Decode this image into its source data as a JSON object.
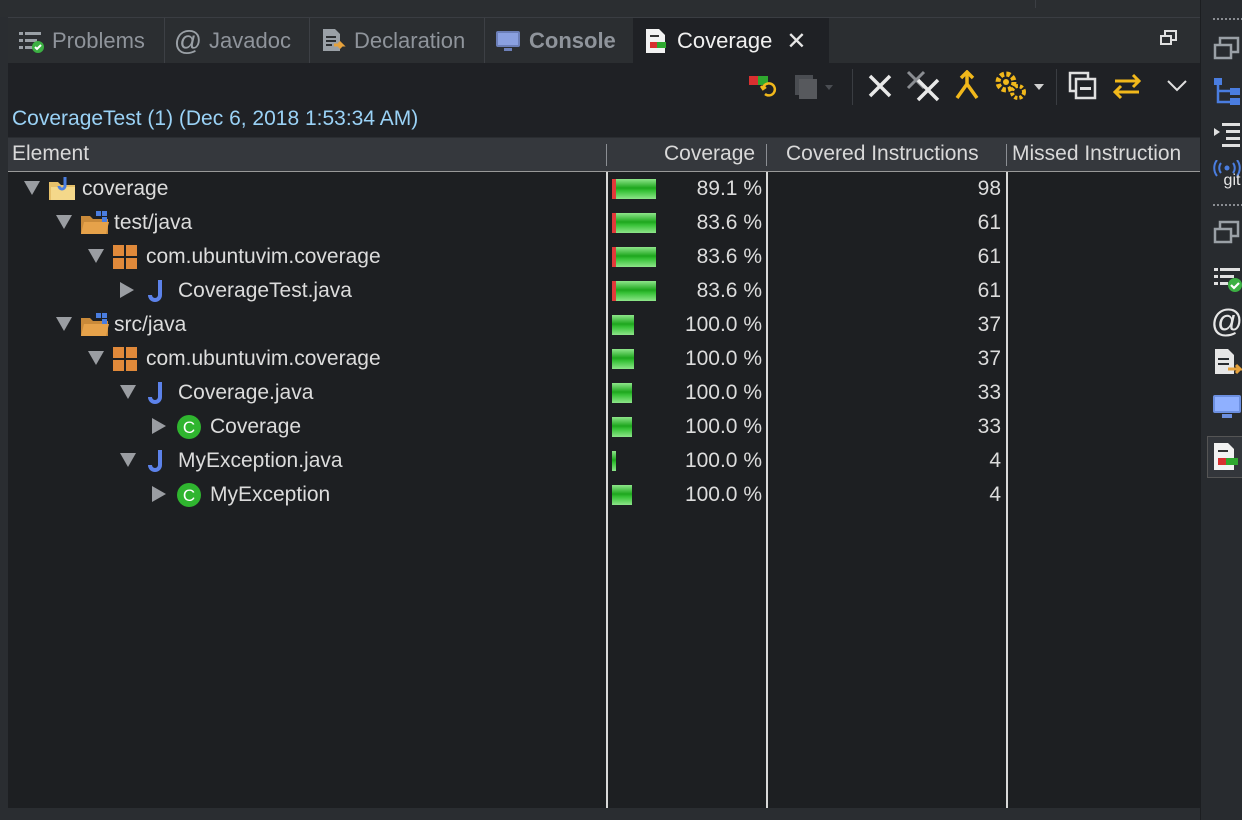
{
  "tabs": [
    {
      "label": "Problems",
      "icon": "problems-icon"
    },
    {
      "label": "Javadoc",
      "icon": "at-icon"
    },
    {
      "label": "Declaration",
      "icon": "declaration-icon"
    },
    {
      "label": "Console",
      "icon": "console-icon"
    },
    {
      "label": "Coverage",
      "icon": "coverage-icon",
      "active": true
    }
  ],
  "session": {
    "title": "CoverageTest (1) (Dec 6, 2018 1:53:34 AM)"
  },
  "columns": [
    "Element",
    "Coverage",
    "Covered Instructions",
    "Missed Instruction"
  ],
  "rows": [
    {
      "name": "coverage",
      "icon": "java-project-icon",
      "expanded": true,
      "coverage": "89.1 %",
      "covered": "98",
      "bar_fraction": 0.92
    },
    {
      "name": "test/java",
      "icon": "source-folder-icon",
      "expanded": true,
      "coverage": "83.6 %",
      "covered": "61",
      "bar_fraction": 0.92
    },
    {
      "name": "com.ubuntuvim.coverage",
      "icon": "package-icon",
      "expanded": true,
      "coverage": "83.6 %",
      "covered": "61",
      "bar_fraction": 0.92
    },
    {
      "name": "CoverageTest.java",
      "icon": "java-file-icon",
      "expanded": false,
      "coverage": "83.6 %",
      "covered": "61",
      "bar_fraction": 0.92
    },
    {
      "name": "src/java",
      "icon": "source-folder-icon",
      "expanded": true,
      "coverage": "100.0 %",
      "covered": "37",
      "bar_fraction": 0.46
    },
    {
      "name": "com.ubuntuvim.coverage",
      "icon": "package-icon",
      "expanded": true,
      "coverage": "100.0 %",
      "covered": "37",
      "bar_fraction": 0.46
    },
    {
      "name": "Coverage.java",
      "icon": "java-file-icon",
      "expanded": true,
      "coverage": "100.0 %",
      "covered": "33",
      "bar_fraction": 0.41
    },
    {
      "name": "Coverage",
      "icon": "class-icon",
      "expanded": false,
      "coverage": "100.0 %",
      "covered": "33",
      "bar_fraction": 0.41
    },
    {
      "name": "MyException.java",
      "icon": "java-file-icon",
      "expanded": true,
      "coverage": "100.0 %",
      "covered": "4",
      "bar_fraction": 0.05
    },
    {
      "name": "MyException",
      "icon": "class-icon",
      "expanded": false,
      "coverage": "100.0 %",
      "covered": "4",
      "bar_fraction": 0.41
    }
  ],
  "colors": {
    "accent": "#9ad2f6",
    "bar_green": "#2fb52f",
    "bar_red": "#e23a3a",
    "toolbar_yellow": "#f1b81b"
  },
  "sidebar": {
    "git_label": "git"
  }
}
